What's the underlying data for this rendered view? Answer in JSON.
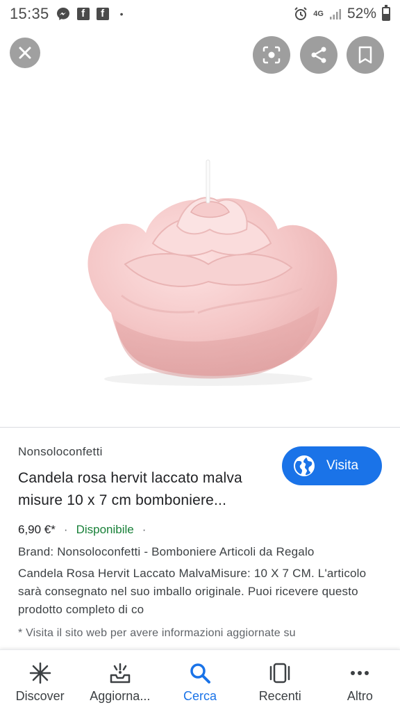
{
  "status_bar": {
    "time": "15:35",
    "left_icons": [
      "messenger-icon",
      "facebook-icon",
      "facebook-icon",
      "dot-icon"
    ],
    "network": "4G",
    "battery_percent": "52%",
    "battery_level": 0.52
  },
  "viewer": {
    "close_icon": "close-icon",
    "lens_icon": "lens-icon",
    "share_icon": "share-icon",
    "save_icon": "bookmark-icon"
  },
  "product": {
    "source": "Nonsoloconfetti",
    "title": "Candela rosa hervit laccato malva misure 10 x 7 cm bomboniere...",
    "price": "6,90 €*",
    "separator": "·",
    "availability": "Disponibile",
    "trailing_dot": "·",
    "brand_line": "Brand: Nonsoloconfetti - Bomboniere Articoli da Regalo",
    "description": "Candela Rosa Hervit Laccato MalvaMisure: 10 X 7 CM. L'articolo sarà consegnato nel suo imballo originale. Puoi ricevere questo prodotto completo di co",
    "note": "* Visita il sito web per avere informazioni aggiornate su",
    "visit_label": "Visita"
  },
  "colors": {
    "accent": "#1a73e8",
    "available": "#188038",
    "candle": "#f4c9c9"
  },
  "bottom_nav": [
    {
      "label": "Discover",
      "icon": "asterisk-icon"
    },
    {
      "label": "Aggiorna...",
      "icon": "updates-icon"
    },
    {
      "label": "Cerca",
      "icon": "search-icon",
      "active": true
    },
    {
      "label": "Recenti",
      "icon": "recents-icon"
    },
    {
      "label": "Altro",
      "icon": "more-icon"
    }
  ]
}
